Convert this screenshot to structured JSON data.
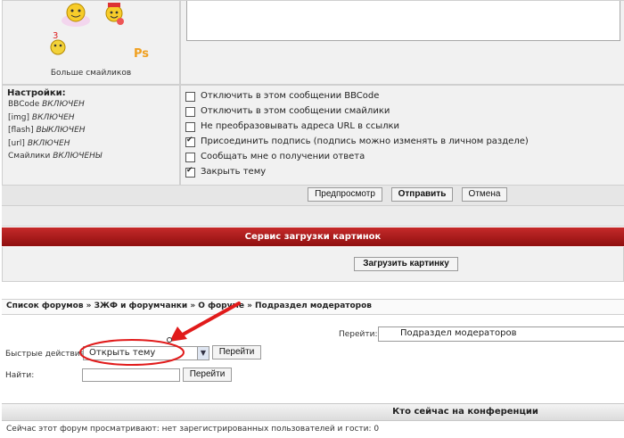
{
  "smilies": {
    "more_label": "Больше смайликов"
  },
  "settings": {
    "heading": "Настройки:",
    "items": [
      {
        "name": "BBCode",
        "state": "ВКЛЮЧЕН"
      },
      {
        "name": "[img]",
        "state": "ВКЛЮЧЕН"
      },
      {
        "name": "[flash]",
        "state": "ВЫКЛЮЧЕН"
      },
      {
        "name": "[url]",
        "state": "ВКЛЮЧЕН"
      },
      {
        "name": "Смайлики",
        "state": "ВКЛЮЧЕНЫ"
      }
    ]
  },
  "options": [
    {
      "label": "Отключить в этом сообщении BBCode",
      "checked": false
    },
    {
      "label": "Отключить в этом сообщении смайлики",
      "checked": false
    },
    {
      "label": "Не преобразовывать адреса URL в ссылки",
      "checked": false
    },
    {
      "label": "Присоединить подпись (подпись можно изменять в личном разделе)",
      "checked": true
    },
    {
      "label": "Сообщать мне о получении ответа",
      "checked": false
    },
    {
      "label": "Закрыть тему",
      "checked": true
    }
  ],
  "actions": {
    "preview": "Предпросмотр",
    "submit": "Отправить",
    "cancel": "Отмена"
  },
  "upload": {
    "title": "Сервис загрузки картинок",
    "button": "Загрузить картинку"
  },
  "breadcrumb": "Список форумов » ЗЖФ и форумчанки » О форуме » Подраздел модераторов",
  "jump": {
    "label": "Перейти:",
    "value": "Подраздел модераторов"
  },
  "quick_actions": {
    "label": "Быстрые действия:",
    "selected": "Открыть тему",
    "go": "Перейти"
  },
  "search": {
    "label": "Найти:",
    "value": "",
    "go": "Перейти"
  },
  "online": {
    "title": "Кто сейчас на конференции",
    "text": "Сейчас этот форум просматривают: нет зарегистрированных пользователей и гости: 0"
  },
  "colors": {
    "header_bar": "#b31b1b",
    "annotation": "#e11b1b"
  }
}
